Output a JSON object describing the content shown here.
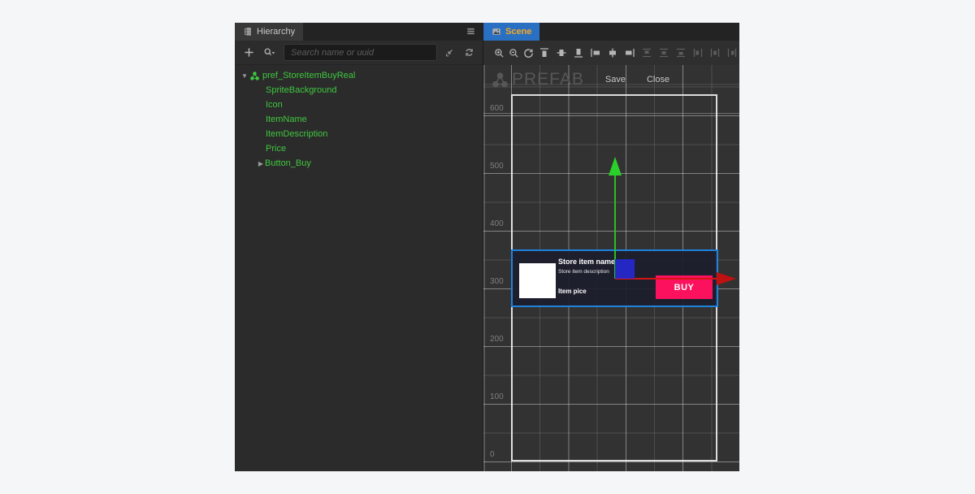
{
  "hierarchy_panel": {
    "tab_label": "Hierarchy",
    "toolbar": {
      "add_icon": "plus",
      "search_filter_icon": "magnifier-dropdown",
      "search_placeholder": "Search name or uuid",
      "collapse_icon": "collapse-all",
      "refresh_icon": "refresh"
    },
    "tree": {
      "root_label": "pref_StoreItemBuyReal",
      "children": [
        "SpriteBackground",
        "Icon",
        "ItemName",
        "ItemDescription",
        "Price",
        "Button_Buy"
      ],
      "text_color": "#3fc73f"
    }
  },
  "scene_panel": {
    "tab_label": "Scene",
    "tab_active_bg": "#2a70c2",
    "tab_text_color": "#f5a623",
    "toolbar_icons": [
      "zoom-in",
      "zoom-out",
      "reset-view",
      "align-top",
      "align-vertical-center",
      "align-bottom",
      "align-left",
      "align-horizontal-center",
      "align-right",
      "distribute-top",
      "distribute-vertical-center",
      "distribute-bottom",
      "distribute-left",
      "distribute-horizontal-center",
      "distribute-right"
    ],
    "prefab_header": {
      "title": "PREFAB",
      "save_label": "Save",
      "close_label": "Close"
    },
    "ruler": [
      "600",
      "500",
      "400",
      "300",
      "200",
      "100",
      "0"
    ],
    "store_item": {
      "name": "Store item name",
      "description": "Store item description",
      "price": "Item pice",
      "buy_label": "BUY",
      "buy_color": "#fb115e",
      "selection_color": "#1f82dd"
    },
    "gizmo": {
      "y_axis_color": "#26c026",
      "x_axis_color": "#bf1111",
      "plane_handle_color": "#2628cf"
    }
  }
}
